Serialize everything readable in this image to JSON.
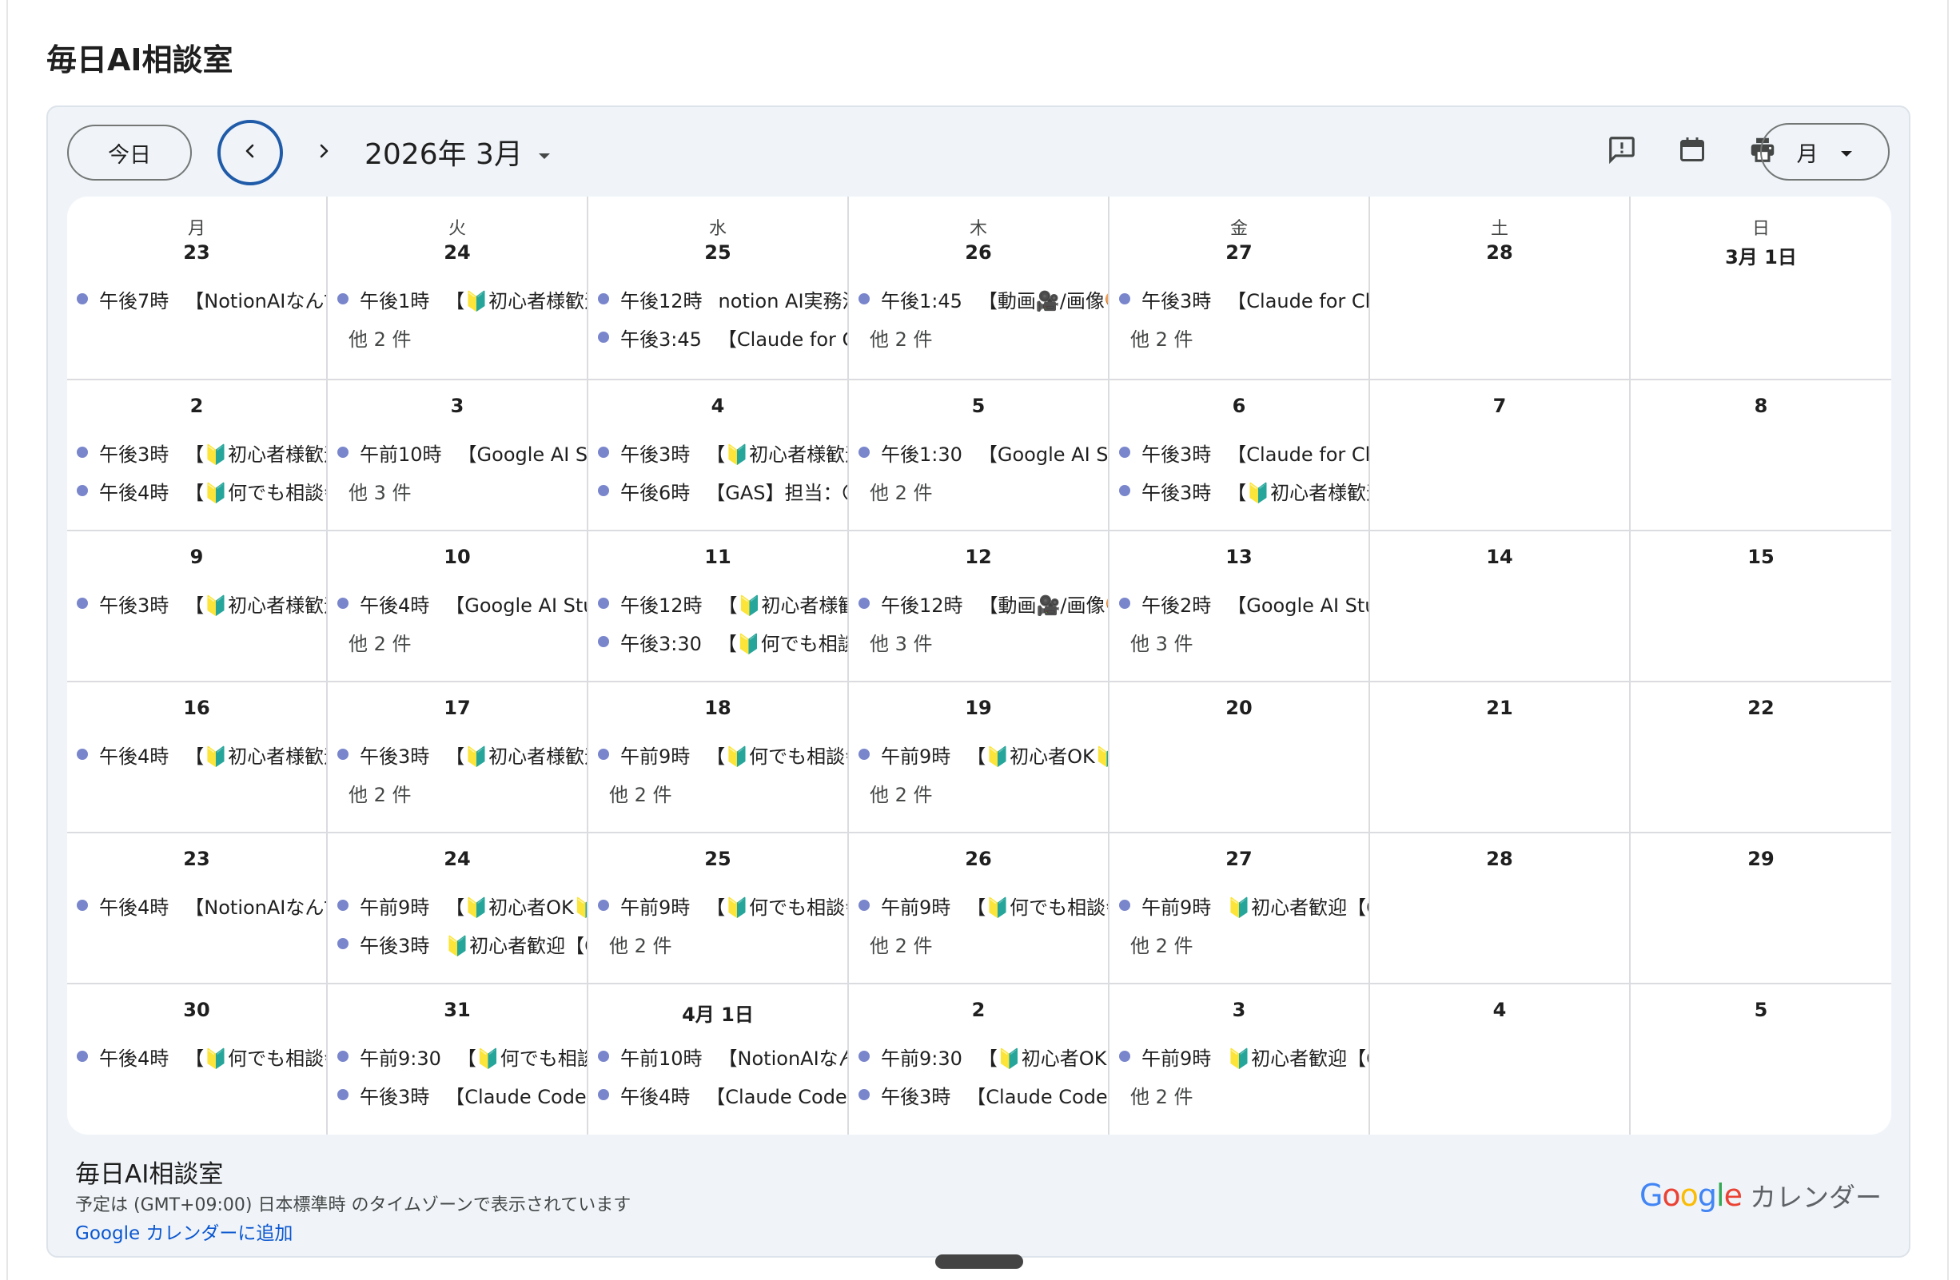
{
  "page": {
    "title": "毎日AI相談室"
  },
  "toolbar": {
    "today_label": "今日",
    "month_label": "2026年 3月",
    "view_label": "月"
  },
  "colors": {
    "event_dot": "#7986cb",
    "link": "#0b57d0",
    "focus_ring": "#1f5ba8"
  },
  "weekdays": [
    "月",
    "火",
    "水",
    "木",
    "金",
    "土",
    "日"
  ],
  "weeks": [
    [
      {
        "day": "23",
        "events": [
          {
            "time": "午後7時",
            "title": "【NotionAIなんでも相談会】"
          }
        ]
      },
      {
        "day": "24",
        "events": [
          {
            "time": "午後1時",
            "title": "【🔰初心者様歓迎】"
          }
        ],
        "more": "他 2 件"
      },
      {
        "day": "25",
        "events": [
          {
            "time": "午後12時",
            "title": "notion AI実務活用"
          },
          {
            "time": "午後3:45",
            "title": "【Claude for Chrome】"
          }
        ]
      },
      {
        "day": "26",
        "events": [
          {
            "time": "午後1:45",
            "title": "【動画🎥/画像🎨】"
          }
        ],
        "more": "他 2 件"
      },
      {
        "day": "27",
        "events": [
          {
            "time": "午後3時",
            "title": "【Claude for Chrome】"
          }
        ],
        "more": "他 2 件"
      },
      {
        "day": "28",
        "events": []
      },
      {
        "day": "3月 1日",
        "events": []
      }
    ],
    [
      {
        "day": "2",
        "events": [
          {
            "time": "午後3時",
            "title": "【🔰初心者様歓迎】"
          },
          {
            "time": "午後4時",
            "title": "【🔰何でも相談会】"
          }
        ]
      },
      {
        "day": "3",
        "events": [
          {
            "time": "午前10時",
            "title": "【Google AI Studio】"
          }
        ],
        "more": "他 3 件"
      },
      {
        "day": "4",
        "events": [
          {
            "time": "午後3時",
            "title": "【🔰初心者様歓迎】"
          },
          {
            "time": "午後6時",
            "title": "【GAS】担当：〇〇"
          }
        ]
      },
      {
        "day": "5",
        "events": [
          {
            "time": "午後1:30",
            "title": "【Google AI Studio】"
          }
        ],
        "more": "他 2 件"
      },
      {
        "day": "6",
        "events": [
          {
            "time": "午後3時",
            "title": "【Claude for Chrome】"
          },
          {
            "time": "午後3時",
            "title": "【🔰初心者様歓迎】"
          }
        ]
      },
      {
        "day": "7",
        "events": []
      },
      {
        "day": "8",
        "events": []
      }
    ],
    [
      {
        "day": "9",
        "events": [
          {
            "time": "午後3時",
            "title": "【🔰初心者様歓迎】"
          }
        ]
      },
      {
        "day": "10",
        "events": [
          {
            "time": "午後4時",
            "title": "【Google AI Studio】"
          }
        ],
        "more": "他 2 件"
      },
      {
        "day": "11",
        "events": [
          {
            "time": "午後12時",
            "title": "【🔰初心者様歓迎】"
          },
          {
            "time": "午後3:30",
            "title": "【🔰何でも相談会】"
          }
        ]
      },
      {
        "day": "12",
        "events": [
          {
            "time": "午後12時",
            "title": "【動画🎥/画像🎨】"
          }
        ],
        "more": "他 3 件"
      },
      {
        "day": "13",
        "events": [
          {
            "time": "午後2時",
            "title": "【Google AI Studio】"
          }
        ],
        "more": "他 3 件"
      },
      {
        "day": "14",
        "events": []
      },
      {
        "day": "15",
        "events": []
      }
    ],
    [
      {
        "day": "16",
        "events": [
          {
            "time": "午後4時",
            "title": "【🔰初心者様歓迎】"
          }
        ]
      },
      {
        "day": "17",
        "events": [
          {
            "time": "午後3時",
            "title": "【🔰初心者様歓迎】"
          }
        ],
        "more": "他 2 件"
      },
      {
        "day": "18",
        "events": [
          {
            "time": "午前9時",
            "title": "【🔰何でも相談会】"
          }
        ],
        "more": "他 2 件"
      },
      {
        "day": "19",
        "events": [
          {
            "time": "午前9時",
            "title": "【🔰初心者OK🔰】"
          }
        ],
        "more": "他 2 件"
      },
      {
        "day": "20",
        "events": []
      },
      {
        "day": "21",
        "events": []
      },
      {
        "day": "22",
        "events": []
      }
    ],
    [
      {
        "day": "23",
        "events": [
          {
            "time": "午後4時",
            "title": "【NotionAIなんでも相談会】"
          }
        ]
      },
      {
        "day": "24",
        "events": [
          {
            "time": "午前9時",
            "title": "【🔰初心者OK🔰】"
          },
          {
            "time": "午後3時",
            "title": "🔰初心者歓迎【Claude】"
          }
        ]
      },
      {
        "day": "25",
        "events": [
          {
            "time": "午前9時",
            "title": "【🔰何でも相談会】"
          }
        ],
        "more": "他 2 件"
      },
      {
        "day": "26",
        "events": [
          {
            "time": "午前9時",
            "title": "【🔰何でも相談会】"
          }
        ],
        "more": "他 2 件"
      },
      {
        "day": "27",
        "events": [
          {
            "time": "午前9時",
            "title": "🔰初心者歓迎【Claude】"
          }
        ],
        "more": "他 2 件"
      },
      {
        "day": "28",
        "events": []
      },
      {
        "day": "29",
        "events": []
      }
    ],
    [
      {
        "day": "30",
        "events": [
          {
            "time": "午後4時",
            "title": "【🔰何でも相談会】"
          }
        ]
      },
      {
        "day": "31",
        "events": [
          {
            "time": "午前9:30",
            "title": "【🔰何でも相談会】"
          },
          {
            "time": "午後3時",
            "title": "【Claude Code】"
          }
        ]
      },
      {
        "day": "4月 1日",
        "events": [
          {
            "time": "午前10時",
            "title": "【NotionAIなんでも相談会】"
          },
          {
            "time": "午後4時",
            "title": "【Claude Code】"
          }
        ]
      },
      {
        "day": "2",
        "events": [
          {
            "time": "午前9:30",
            "title": "【🔰初心者OK🔰】"
          },
          {
            "time": "午後3時",
            "title": "【Claude Code】"
          }
        ]
      },
      {
        "day": "3",
        "events": [
          {
            "time": "午前9時",
            "title": "🔰初心者歓迎【Claude】"
          }
        ],
        "more": "他 2 件"
      },
      {
        "day": "4",
        "events": []
      },
      {
        "day": "5",
        "events": []
      }
    ]
  ],
  "footer": {
    "title": "毎日AI相談室",
    "timezone_note": "予定は (GMT+09:00) 日本標準時 のタイムゾーンで表示されています",
    "add_link": "Google カレンダーに追加",
    "brand_google": "Google",
    "brand_calendar": "カレンダー"
  },
  "icons": {
    "prev": "chevron-left-icon",
    "next": "chevron-right-icon",
    "month_dropdown": "caret-down-icon",
    "feedback": "feedback-icon",
    "calendar": "calendar-icon",
    "print": "print-icon",
    "view_dropdown": "caret-down-icon"
  }
}
